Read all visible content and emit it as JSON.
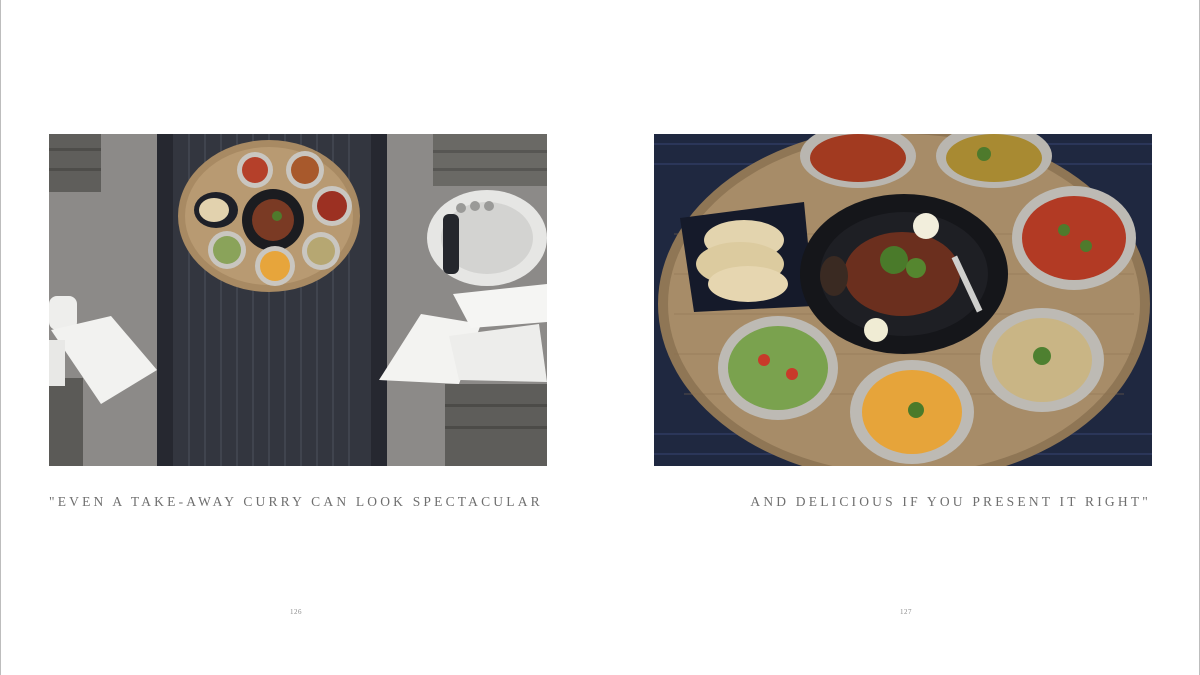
{
  "left_page": {
    "caption": "\"EVEN A TAKE-AWAY CURRY CAN LOOK SPECTACULAR",
    "page_number": "126",
    "photo": {
      "subject": "overhead table setting with curry dishes on a round woven tray"
    }
  },
  "right_page": {
    "caption": "AND DELICIOUS IF YOU PRESENT IT RIGHT\"",
    "page_number": "127",
    "photo": {
      "subject": "close-up of curry dishes on a round woven tray"
    }
  },
  "colors": {
    "caption_text": "#6f6f6f",
    "gutter": "#4a4a4a",
    "table_grey": "#8a8886",
    "runner_dark": "#2b2d33",
    "tray_wicker": "#b89a72"
  }
}
